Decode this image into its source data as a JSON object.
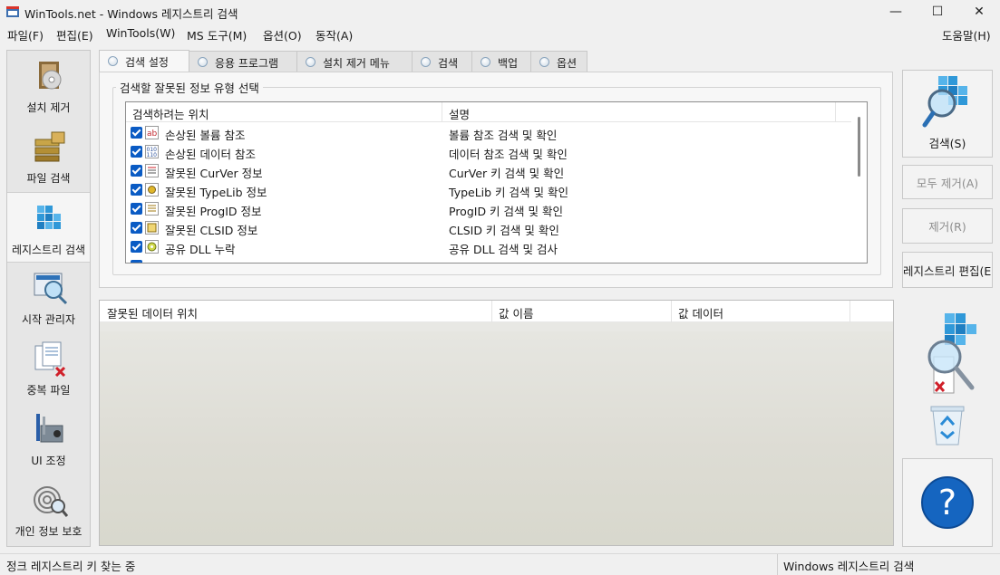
{
  "window": {
    "title": "WinTools.net - Windows 레지스트리 검색",
    "minimize_glyph": "—",
    "maximize_glyph": "☐",
    "close_glyph": "✕"
  },
  "menubar": {
    "items": [
      "파일(F)",
      "편집(E)",
      "WinTools(W)",
      "MS 도구(M)",
      "옵션(O)",
      "동작(A)"
    ],
    "help": "도움말(H)"
  },
  "sidebar": {
    "items": [
      {
        "label": "설치 제거",
        "icon": "uninstall-icon"
      },
      {
        "label": "파일 검색",
        "icon": "file-search-icon"
      },
      {
        "label": "레지스트리 검색",
        "icon": "registry-icon"
      },
      {
        "label": "시작 관리자",
        "icon": "startup-manager-icon"
      },
      {
        "label": "중복 파일",
        "icon": "duplicate-files-icon"
      },
      {
        "label": "UI 조정",
        "icon": "tools-icon"
      },
      {
        "label": "개인 정보 보호",
        "icon": "fingerprint-icon"
      }
    ],
    "active_index": 2
  },
  "tabs": [
    "검색 설정",
    "응용 프로그램",
    "설치 제거 메뉴",
    "검색",
    "백업",
    "옵션"
  ],
  "group_title": "검색할 잘못된 정보 유형 선택",
  "list": {
    "headers": [
      "검색하려는 위치",
      "설명"
    ],
    "rows": [
      {
        "name": "손상된 볼륨 참조",
        "desc": "볼륨 참조 검색 및 확인",
        "checked": true,
        "icon": "ab-icon"
      },
      {
        "name": "손상된 데이터 참조",
        "desc": "데이터 참조 검색 및 확인",
        "checked": true,
        "icon": "binary-icon"
      },
      {
        "name": "잘못된 CurVer 정보",
        "desc": "CurVer 키 검색 및 확인",
        "checked": true,
        "icon": "curver-icon"
      },
      {
        "name": "잘못된 TypeLib 정보",
        "desc": "TypeLib 키 검색 및 확인",
        "checked": true,
        "icon": "typelib-icon"
      },
      {
        "name": "잘못된 ProgID 정보",
        "desc": "ProgID 키 검색 및 확인",
        "checked": true,
        "icon": "progid-icon"
      },
      {
        "name": "잘못된 CLSID 정보",
        "desc": "CLSID 키 검색 및 확인",
        "checked": true,
        "icon": "clsid-icon"
      },
      {
        "name": "공유 DLL 누락",
        "desc": "공유 DLL 검색 및 검사",
        "checked": true,
        "icon": "dll-icon"
      }
    ]
  },
  "results": {
    "headers": [
      "잘못된 데이터 위치",
      "값 이름",
      "값 데이터"
    ]
  },
  "buttons": {
    "search": "검색(S)",
    "remove_all": "모두 제거(A)",
    "remove": "제거(R)",
    "registry_editor": "레지스트리 편집(E)",
    "help_glyph": "?"
  },
  "status": {
    "left": "정크 레지스트리 키 찾는 중",
    "right": "Windows 레지스트리 검색"
  },
  "colors": {
    "accent": "#0a5bc4",
    "help_button": "#1565c0",
    "cube": "#1f8fd6"
  }
}
